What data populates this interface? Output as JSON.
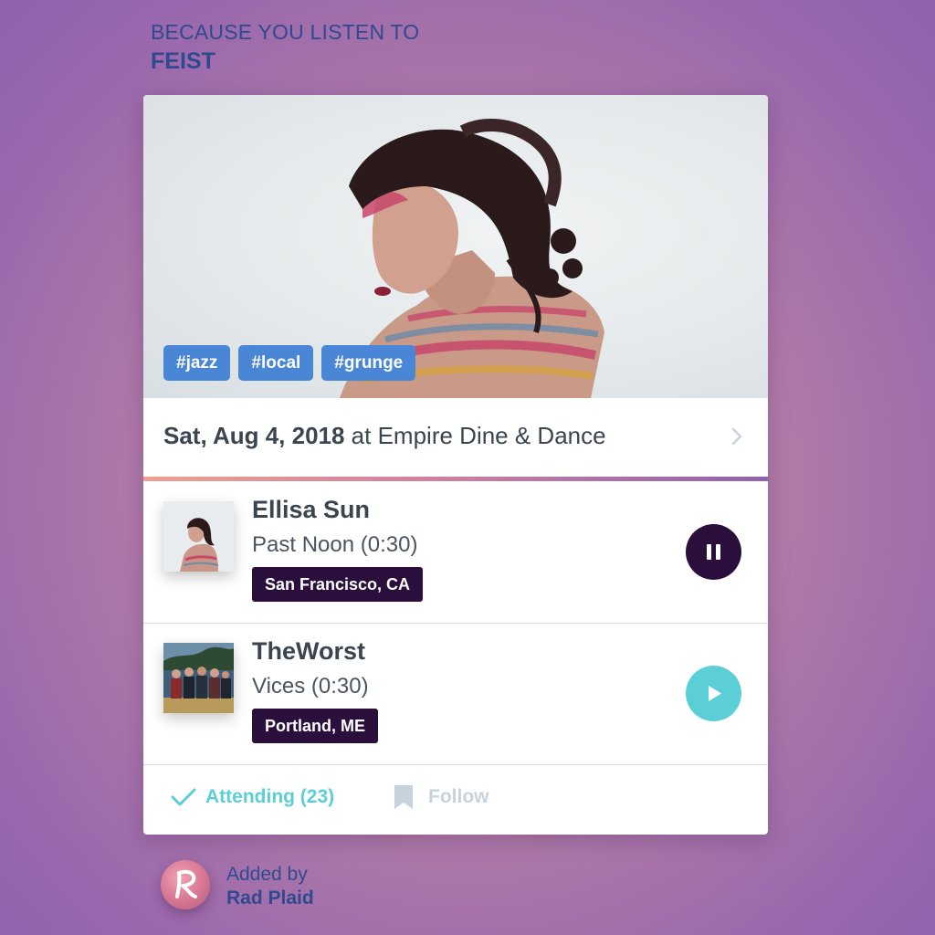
{
  "header": {
    "reason_label": "BECAUSE YOU LISTEN TO",
    "artist": "FEIST"
  },
  "event": {
    "tags": [
      "#jazz",
      "#local",
      "#grunge"
    ],
    "date": "Sat, Aug 4, 2018",
    "venue_text": " at Empire Dine & Dance"
  },
  "tracks": [
    {
      "artist": "Ellisa Sun",
      "song": "Past Noon (0:30)",
      "location": "San Francisco, CA",
      "state": "playing",
      "control_icon": "pause-icon"
    },
    {
      "artist": "TheWorst",
      "song": "Vices (0:30)",
      "location": "Portland, ME",
      "state": "paused",
      "control_icon": "play-icon"
    }
  ],
  "actions": {
    "attending_label": "Attending (23)",
    "follow_label": "Follow"
  },
  "added_by": {
    "label": "Added by",
    "name": "Rad Plaid"
  },
  "colors": {
    "accent_teal": "#5ccfd6",
    "tag_blue": "#4a86d6",
    "dark_purple": "#2a0f3d",
    "header_blue": "#2f4a8e"
  }
}
